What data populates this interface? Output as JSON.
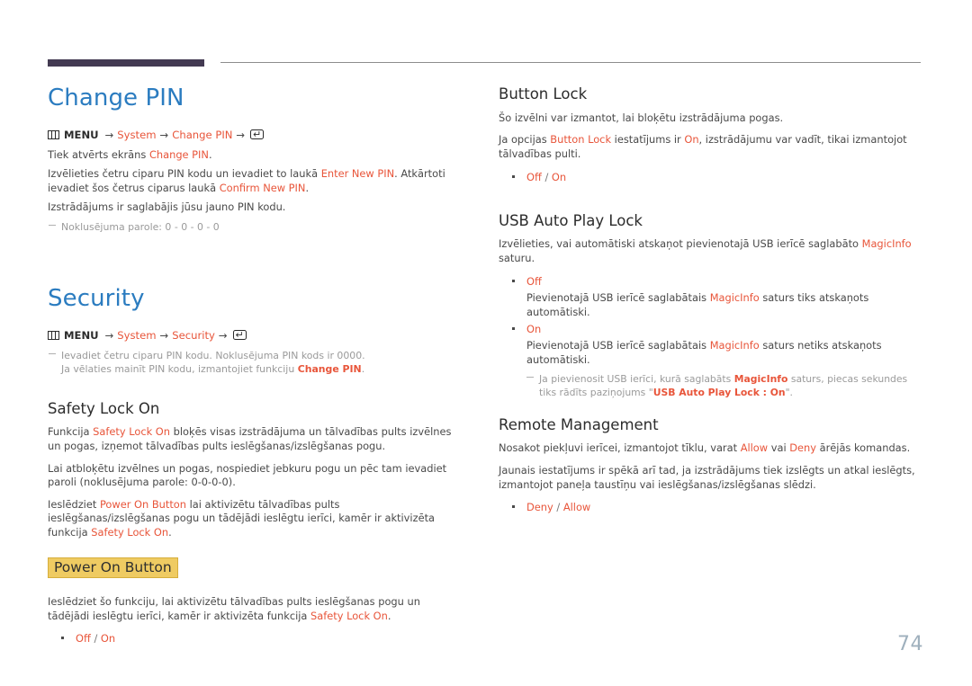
{
  "page": {
    "number": "74",
    "accent_blue": "#2b7cc0",
    "accent_orange": "#e8553a",
    "highlight_yellow": "#efcb62",
    "rule_dark": "#433a52"
  },
  "left_column": {
    "change_pin": {
      "title": "Change PIN",
      "menu_path": {
        "icon": "menu-grid-icon",
        "label": "MENU",
        "arrow": "→",
        "step1": "System",
        "step2": "Change PIN",
        "enter_icon": "enter-key-icon",
        "enter_glyph": "↵"
      },
      "p1_pre": "Tiek atvērts ekrāns ",
      "p1_link": "Change PIN",
      "p1_post": ".",
      "p2_pre": "Izvēlieties četru ciparu PIN kodu un ievadiet to laukā ",
      "p2_link1": "Enter New PIN",
      "p2_mid": ". Atkārtoti ievadiet šos četrus ciparus laukā ",
      "p2_link2": "Confirm New PIN",
      "p2_post": ".",
      "p3": "Izstrādājums ir saglabājis jūsu jauno PIN kodu.",
      "note": "Noklusējuma parole: 0 - 0 - 0 - 0"
    },
    "security": {
      "title": "Security",
      "menu_path": {
        "icon": "menu-grid-icon",
        "label": "MENU",
        "arrow": "→",
        "step1": "System",
        "step2": "Security",
        "enter_icon": "enter-key-icon",
        "enter_glyph": "↵"
      },
      "note_line1": "Ievadiet četru ciparu PIN kodu. Noklusējuma PIN kods ir 0000.",
      "note_line2_pre": "Ja vēlaties mainīt PIN kodu, izmantojiet funkciju ",
      "note_line2_link": "Change PIN",
      "note_line2_post": "."
    },
    "safety_lock_on": {
      "title": "Safety Lock On",
      "p1_pre": "Funkcija ",
      "p1_link": "Safety Lock On",
      "p1_post": " bloķēs visas izstrādājuma un tālvadības pults izvēlnes un pogas, izņemot tālvadības pults ieslēgšanas/izslēgšanas pogu.",
      "p2": "Lai atbloķētu izvēlnes un pogas, nospiediet jebkuru pogu un pēc tam ievadiet paroli (noklusējuma parole: 0-0-0-0).",
      "p3_pre": "Ieslēdziet ",
      "p3_link1": "Power On Button",
      "p3_mid": " lai aktivizētu tālvadības pults ieslēgšanas/izslēgšanas pogu un tādējādi ieslēgtu ierīci, kamēr ir aktivizēta funkcija ",
      "p3_link2": "Safety Lock On",
      "p3_post": "."
    },
    "power_on_button": {
      "title": "Power On Button",
      "p1_pre": "Ieslēdziet šo funkciju, lai aktivizētu tālvadības pults ieslēgšanas pogu un tādējādi ieslēgtu ierīci, kamēr ir aktivizēta funkcija ",
      "p1_link": "Safety Lock On",
      "p1_post": ".",
      "options": {
        "opt1": "Off",
        "sep": " / ",
        "opt2": "On"
      }
    }
  },
  "right_column": {
    "button_lock": {
      "title": "Button Lock",
      "p1": "Šo izvēlni var izmantot, lai bloķētu izstrādājuma pogas.",
      "p2_pre": "Ja opcijas ",
      "p2_link1": "Button Lock",
      "p2_mid": " iestatījums ir ",
      "p2_link2": "On",
      "p2_post": ", izstrādājumu var vadīt, tikai izmantojot tālvadības pulti.",
      "options": {
        "opt1": "Off",
        "sep": " / ",
        "opt2": "On"
      }
    },
    "usb_auto_play_lock": {
      "title": "USB Auto Play Lock",
      "p1_pre": "Izvēlieties, vai automātiski atskaņot pievienotajā USB ierīcē saglabāto ",
      "p1_link": "MagicInfo",
      "p1_post": " saturu.",
      "bullets": [
        {
          "label": "Off",
          "desc_pre": "Pievienotajā USB ierīcē saglabātais ",
          "desc_link": "MagicInfo",
          "desc_post": " saturs tiks atskaņots automātiski."
        },
        {
          "label": "On",
          "desc_pre": "Pievienotajā USB ierīcē saglabātais ",
          "desc_link": "MagicInfo",
          "desc_post": " saturs netiks atskaņots automātiski.",
          "note_pre": "Ja pievienosit USB ierīci, kurā saglabāts ",
          "note_link1": "MagicInfo",
          "note_mid": " saturs, piecas sekundes tiks rādīts paziņojums \"",
          "note_link2": "USB Auto Play Lock : On",
          "note_post": "\"."
        }
      ]
    },
    "remote_management": {
      "title": "Remote Management",
      "p1_pre": "Nosakot piekļuvi ierīcei, izmantojot tīklu, varat ",
      "p1_link1": "Allow",
      "p1_mid": " vai ",
      "p1_link2": "Deny",
      "p1_post": " ārējās komandas.",
      "p2": "Jaunais iestatījums ir spēkā arī tad, ja izstrādājums tiek izslēgts un atkal ieslēgts, izmantojot paneļa taustīņu vai ieslēgšanas/izslēgšanas slēdzi.",
      "options": {
        "opt1": "Deny",
        "sep": " / ",
        "opt2": "Allow"
      }
    }
  }
}
